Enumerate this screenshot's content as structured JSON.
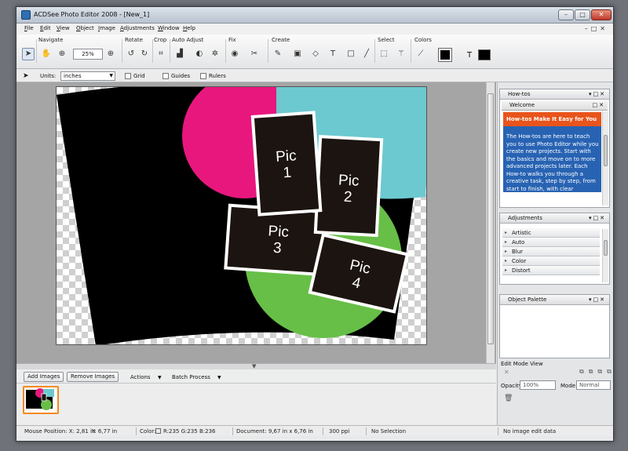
{
  "window": {
    "title": "ACDSee Photo Editor 2008 - [New_1]"
  },
  "menu": [
    "File",
    "Edit",
    "View",
    "Object",
    "Image",
    "Adjustments",
    "Window",
    "Help"
  ],
  "toolbar": {
    "groups": [
      "Navigate",
      "Rotate",
      "Crop",
      "Auto Adjust",
      "Fix",
      "Create",
      "Select",
      "Colors"
    ],
    "zoom": "25%",
    "units_label": "Units:",
    "units_value": "inches",
    "grid_label": "Grid",
    "guides_label": "Guides",
    "rulers_label": "Rulers"
  },
  "canvas": {
    "pics": [
      {
        "label": "Pic\n1"
      },
      {
        "label": "Pic\n2"
      },
      {
        "label": "Pic\n3"
      },
      {
        "label": "Pic\n4"
      }
    ],
    "colors": {
      "pink": "#e8177e",
      "teal": "#6cc9cf",
      "green": "#67bf47",
      "frame": "#1c1410"
    }
  },
  "filmbar": {
    "add_images": "Add Images",
    "remove_images": "Remove Images",
    "actions": "Actions",
    "batch_process": "Batch Process"
  },
  "status": {
    "mouse": "Mouse Position: X: 2,81 in",
    "mouse_y": "Y: 6,77 in",
    "color": "Color:",
    "rgb": "R:235  G:235  B:236",
    "document": "Document: 9,67 in x 6,76 in",
    "ppi": "300 ppi",
    "selection": "No Selection",
    "edit_data": "No image edit data"
  },
  "panels": {
    "howtos": {
      "title": "How-tos",
      "welcome": "Welcome",
      "banner": "How-tos Make It Easy for You",
      "body": "The How-tos are here to teach you to use Photo Editor while you create new projects. Start with the basics and move on to more advanced projects later. Each How-to walks you through a creative task, step by step, from start to finish, with clear"
    },
    "adjustments": {
      "title": "Adjustments",
      "items": [
        "Artistic",
        "Auto",
        "Blur",
        "Color",
        "Distort"
      ]
    },
    "object_palette": {
      "title": "Object Palette"
    },
    "edit_mode": {
      "label": "Edit Mode View",
      "opacity_label": "Opacity",
      "opacity_value": "100%",
      "mode_label": "Mode",
      "mode_value": "Normal"
    }
  }
}
